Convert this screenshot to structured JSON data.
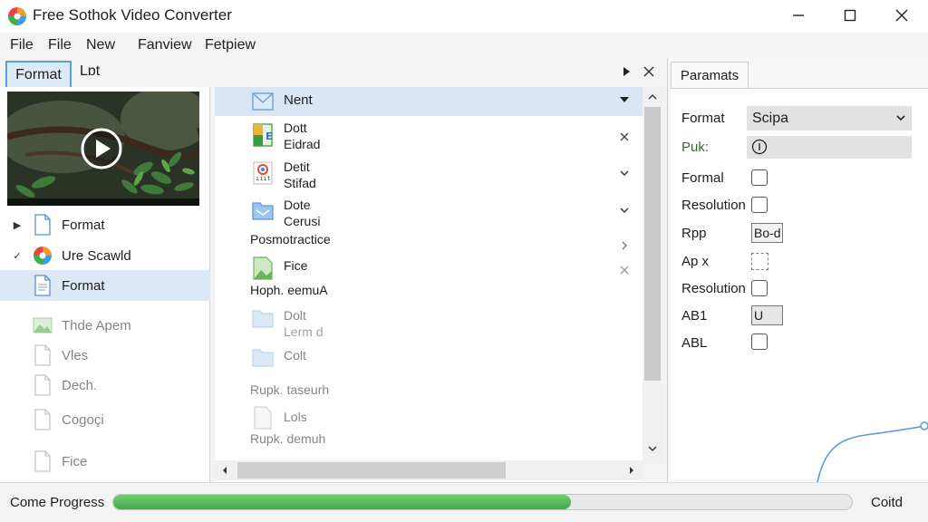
{
  "window": {
    "title": "Free Sothok Video Converter",
    "controls": [
      "minimize",
      "maximize",
      "close"
    ]
  },
  "menu": [
    "File",
    "File",
    "New",
    "Fanview",
    "Fetpiew"
  ],
  "left_tabs": [
    "Format",
    "Lɒt"
  ],
  "tree": [
    {
      "label": "Format",
      "caret": "▶",
      "icon": "document-icon"
    },
    {
      "label": "Ure Scawld",
      "caret": "✓",
      "icon": "color-wheel-icon"
    },
    {
      "label": "Format",
      "caret": "",
      "icon": "document-icon",
      "selected": true
    },
    {
      "label": "Thde Apem",
      "caret": "",
      "icon": "image-icon"
    },
    {
      "label": "Vles",
      "caret": "",
      "icon": "document-icon"
    },
    {
      "label": "Dech.",
      "caret": "",
      "icon": "document-icon"
    },
    {
      "label": "Cogoçi",
      "caret": "",
      "icon": "document-icon"
    },
    {
      "label": "Fice",
      "caret": "",
      "icon": "document-icon"
    }
  ],
  "list": {
    "selected_item": "Nent",
    "items": [
      {
        "line1": "Dott",
        "line2": "Eidrad"
      },
      {
        "line1": "Detit",
        "line2": "Stifad"
      },
      {
        "line1": "Dote",
        "line2": "Cerusi"
      },
      {
        "line1": "Fice",
        "line2": ""
      },
      {
        "line1": "Dolt",
        "line2": "Lerm d"
      },
      {
        "line1": "Colt",
        "line2": ""
      },
      {
        "line1": "Lols",
        "line2": ""
      }
    ],
    "sub_labels": [
      "Posmotractice",
      "Hoph. eemuA",
      "Rupk. taseurh",
      "Rupk. demuh"
    ]
  },
  "params": {
    "tab": "Paramats",
    "rows": [
      {
        "label": "Format",
        "value": "Scipa"
      },
      {
        "label": "Puk:"
      },
      {
        "label": "Formal"
      },
      {
        "label": "Resolution"
      },
      {
        "label": "Rpp",
        "value": "Bo-d"
      },
      {
        "label": "Ap x"
      },
      {
        "label": "Resolution"
      },
      {
        "label": "AB1",
        "value": "U"
      },
      {
        "label": "ABL"
      }
    ]
  },
  "status": {
    "label": "Come Progress",
    "progress": 0.62,
    "right_label": "Coitd"
  },
  "colors": {
    "accent": "#5a9de0",
    "selection": "#dce8f6",
    "progress": "#4cbb52"
  }
}
